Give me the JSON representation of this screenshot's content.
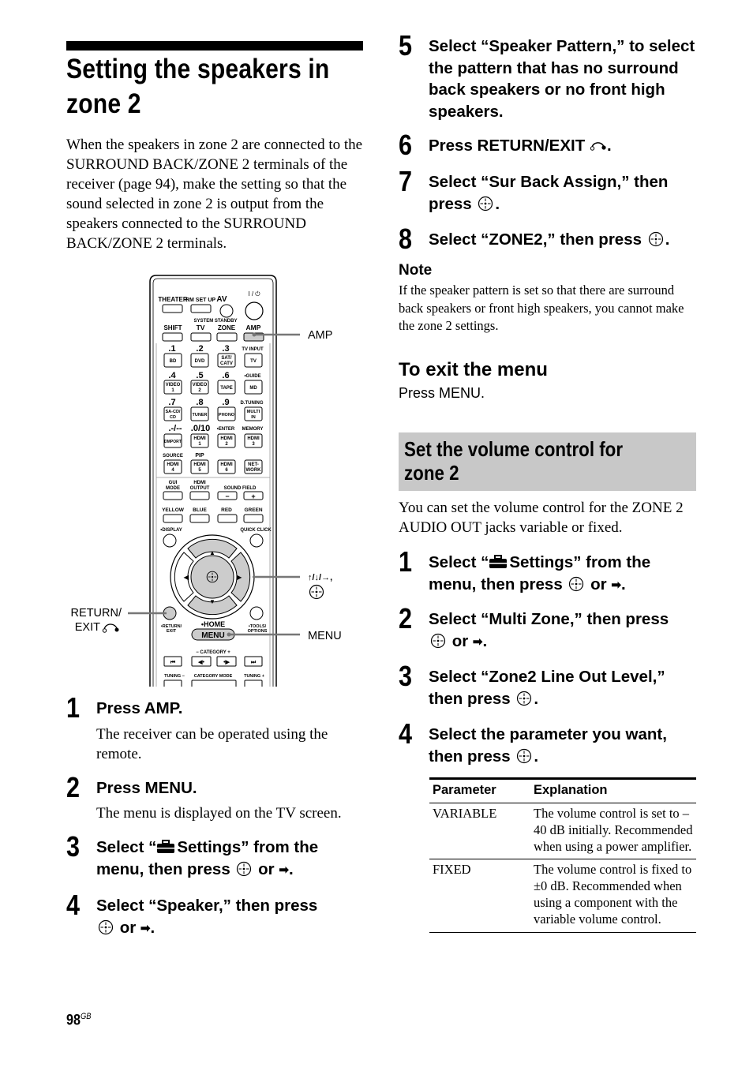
{
  "page": {
    "title": "Setting the speakers in zone 2",
    "intro": "When the speakers in zone 2 are connected to the SURROUND BACK/ZONE 2 terminals of the receiver (page 94), make the setting so that the sound selected in zone 2 is output from the speakers connected to the SURROUND BACK/ZONE 2 terminals.",
    "page_number": "98",
    "page_suffix": "GB"
  },
  "remote": {
    "callouts": {
      "amp": "AMP",
      "arrows": "↑/↓/→,",
      "return_line1": "RETURN/",
      "return_line2": "EXIT",
      "menu": "MENU"
    },
    "labels": {
      "theater": "THEATER",
      "rm_set_up": "RM SET UP",
      "av": "AV",
      "power": "I / ⏻",
      "system_standby": "SYSTEM STANDBY",
      "shift": "SHIFT",
      "tv": "TV",
      "zone": "ZONE",
      "amp": "AMP",
      "n1": ".1",
      "n2": ".2",
      "n3": ".3",
      "tv_input": "TV INPUT",
      "bd": "BD",
      "dvd": "DVD",
      "sat1": "SAT/",
      "sat2": "CATV",
      "tv_btn": "TV",
      "n4": ".4",
      "n5": ".5",
      "n6": ".6",
      "guide": "•GUIDE",
      "video1": "VIDEO",
      "video1b": "1",
      "video2": "VIDEO",
      "video2b": "2",
      "tape": "TAPE",
      "md": "MD",
      "n7": ".7",
      "n8": ".8",
      "n9": ".9",
      "dtuning": "D.TUNING",
      "sacd1": "SA-CD/",
      "sacd2": "CD",
      "tuner": "TUNER",
      "phono": "PHONO",
      "multi1": "MULTI",
      "multi2": "IN",
      "dash": ".-/--",
      "n0": ".0/10",
      "enter": "•ENTER",
      "memory": "MEMORY",
      "dmport": "DMPORT",
      "hdmi": "HDMI",
      "h1": "1",
      "h2": "2",
      "h3": "3",
      "source": "SOURCE",
      "pip": "PIP",
      "h4": "4",
      "h5": "5",
      "h6": "6",
      "net1": "NET-",
      "net2": "WORK",
      "gui1": "GUI",
      "gui2": "MODE",
      "hout1": "HDMI",
      "hout2": "OUTPUT",
      "sound_field": "SOUND FIELD",
      "minus": "−",
      "plus": "+",
      "yellow": "YELLOW",
      "blue": "BLUE",
      "red": "RED",
      "green": "GREEN",
      "display": "•DISPLAY",
      "quick_click": "QUICK CLICK",
      "return1": "•RETURN/",
      "return2": "EXIT",
      "home": "•HOME",
      "tools1": "•TOOLS/",
      "tools2": "OPTIONS",
      "menu": "MENU",
      "category": "− CATEGORY +",
      "tuning_minus": "TUNING −",
      "category_mode": "CATEGORY MODE",
      "tuning_plus": "TUNING +"
    }
  },
  "steps_left": [
    {
      "num": "1",
      "text": "Press AMP.",
      "desc": "The receiver can be operated using the remote."
    },
    {
      "num": "2",
      "text": "Press MENU.",
      "desc": "The menu is displayed on the TV screen."
    },
    {
      "num": "3",
      "pre": "Select “",
      "settings": "Settings",
      "mid": "” from the menu, then press",
      "or": "or",
      "end": "."
    },
    {
      "num": "4",
      "pre": "Select “Speaker,” then press",
      "or": "or",
      "end": "."
    }
  ],
  "steps_right": [
    {
      "num": "5",
      "text": "Select “Speaker Pattern,” to select the pattern that has no surround back speakers or no front high speakers."
    },
    {
      "num": "6",
      "pre": "Press RETURN/EXIT",
      "end": "."
    },
    {
      "num": "7",
      "pre": "Select “Sur Back Assign,” then press",
      "end": "."
    },
    {
      "num": "8",
      "pre": "Select “ZONE2,” then press",
      "end": "."
    }
  ],
  "note": {
    "title": "Note",
    "text": "If the speaker pattern is set so that there are surround back speakers or front high speakers, you cannot make the zone 2 settings."
  },
  "exit_menu": {
    "title": "To exit the menu",
    "text": "Press MENU."
  },
  "volume_section": {
    "title_line1": "Set the volume control for",
    "title_line2": "zone 2",
    "intro": "You can set the volume control for the ZONE 2 AUDIO OUT jacks variable or fixed.",
    "steps": [
      {
        "num": "1",
        "pre": "Select “",
        "settings": "Settings",
        "mid": "” from the menu, then press",
        "or": "or",
        "end": "."
      },
      {
        "num": "2",
        "pre": "Select “Multi Zone,” then press",
        "or": "or",
        "end": "."
      },
      {
        "num": "3",
        "pre": "Select “Zone2 Line Out Level,” then press",
        "end": "."
      },
      {
        "num": "4",
        "pre": "Select the parameter you want, then press",
        "end": "."
      }
    ],
    "table": {
      "headers": [
        "Parameter",
        "Explanation"
      ],
      "rows": [
        {
          "param": "VARIABLE",
          "explanation": "The volume control is set to –40 dB initially. Recommended when using a power amplifier."
        },
        {
          "param": "FIXED",
          "explanation": "The volume control is fixed to ±0 dB. Recommended when using a component with the variable volume control."
        }
      ]
    }
  }
}
